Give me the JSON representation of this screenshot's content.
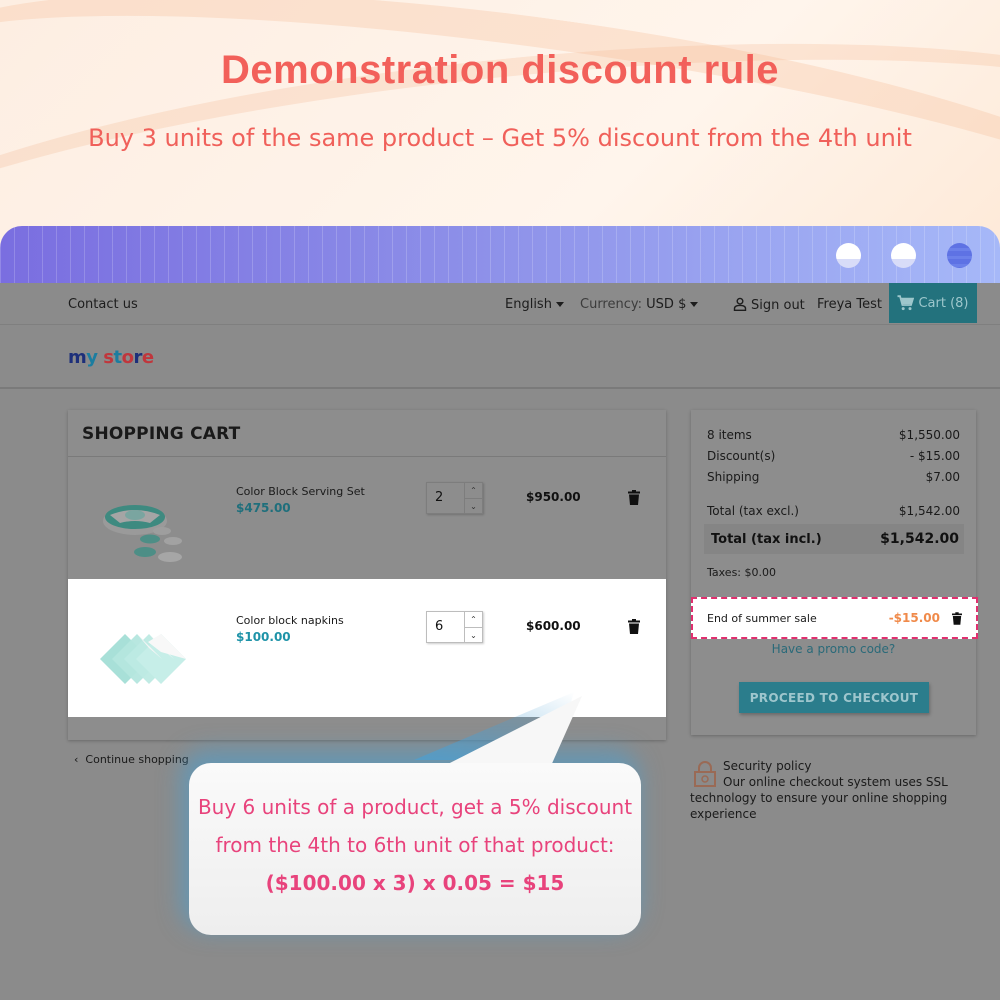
{
  "banner": {
    "title": "Demonstration discount rule",
    "subtitle": "Buy 3 units of the same product – Get 5% discount from the 4th unit"
  },
  "browser": {
    "buttons": [
      "minimize",
      "maximize",
      "close"
    ]
  },
  "topnav": {
    "contact": "Contact us",
    "language": "English",
    "currency_label": "Currency:",
    "currency_value": "USD $",
    "sign_out": "Sign out",
    "user": "Freya Test",
    "cart": "Cart (8)"
  },
  "logo": {
    "parts": [
      "m",
      "y",
      "s",
      "t",
      "o",
      "r",
      "e"
    ]
  },
  "cart": {
    "title": "SHOPPING CART",
    "items": [
      {
        "name": "Color Block Serving Set",
        "unit_price": "$475.00",
        "quantity": "2",
        "total": "$950.00"
      },
      {
        "name": "Color block napkins",
        "unit_price": "$100.00",
        "quantity": "6",
        "total": "$600.00"
      }
    ],
    "continue_shopping": "Continue shopping"
  },
  "summary": {
    "items_label": "8 items",
    "items_value": "$1,550.00",
    "discount_label": "Discount(s)",
    "discount_value": "- $15.00",
    "shipping_label": "Shipping",
    "shipping_value": "$7.00",
    "total_excl_label": "Total (tax excl.)",
    "total_excl_value": "$1,542.00",
    "total_incl_label": "Total (tax incl.)",
    "total_incl_value": "$1,542.00",
    "taxes": "Taxes: $0.00",
    "voucher_name": "End of summer sale",
    "voucher_amount": "-$15.00",
    "promo_link": "Have a promo code?",
    "checkout_button": "PROCEED TO CHECKOUT"
  },
  "security": {
    "title": "Security policy",
    "body": "Our online checkout system uses SSL technology to ensure your online shopping experience"
  },
  "callout": {
    "text_plain": "Buy 6 units of a product, get a 5% discount from the 4th to 6th unit of that product: ",
    "text_bold": "($100.00 x 3) x 0.05 = $15"
  },
  "colors": {
    "headline": "#f2605a",
    "accent_teal": "#23727d",
    "price_teal": "#1e93a8",
    "voucher_border": "#e0306f",
    "voucher_amount": "#f08a4a",
    "callout_text": "#e8437c"
  }
}
